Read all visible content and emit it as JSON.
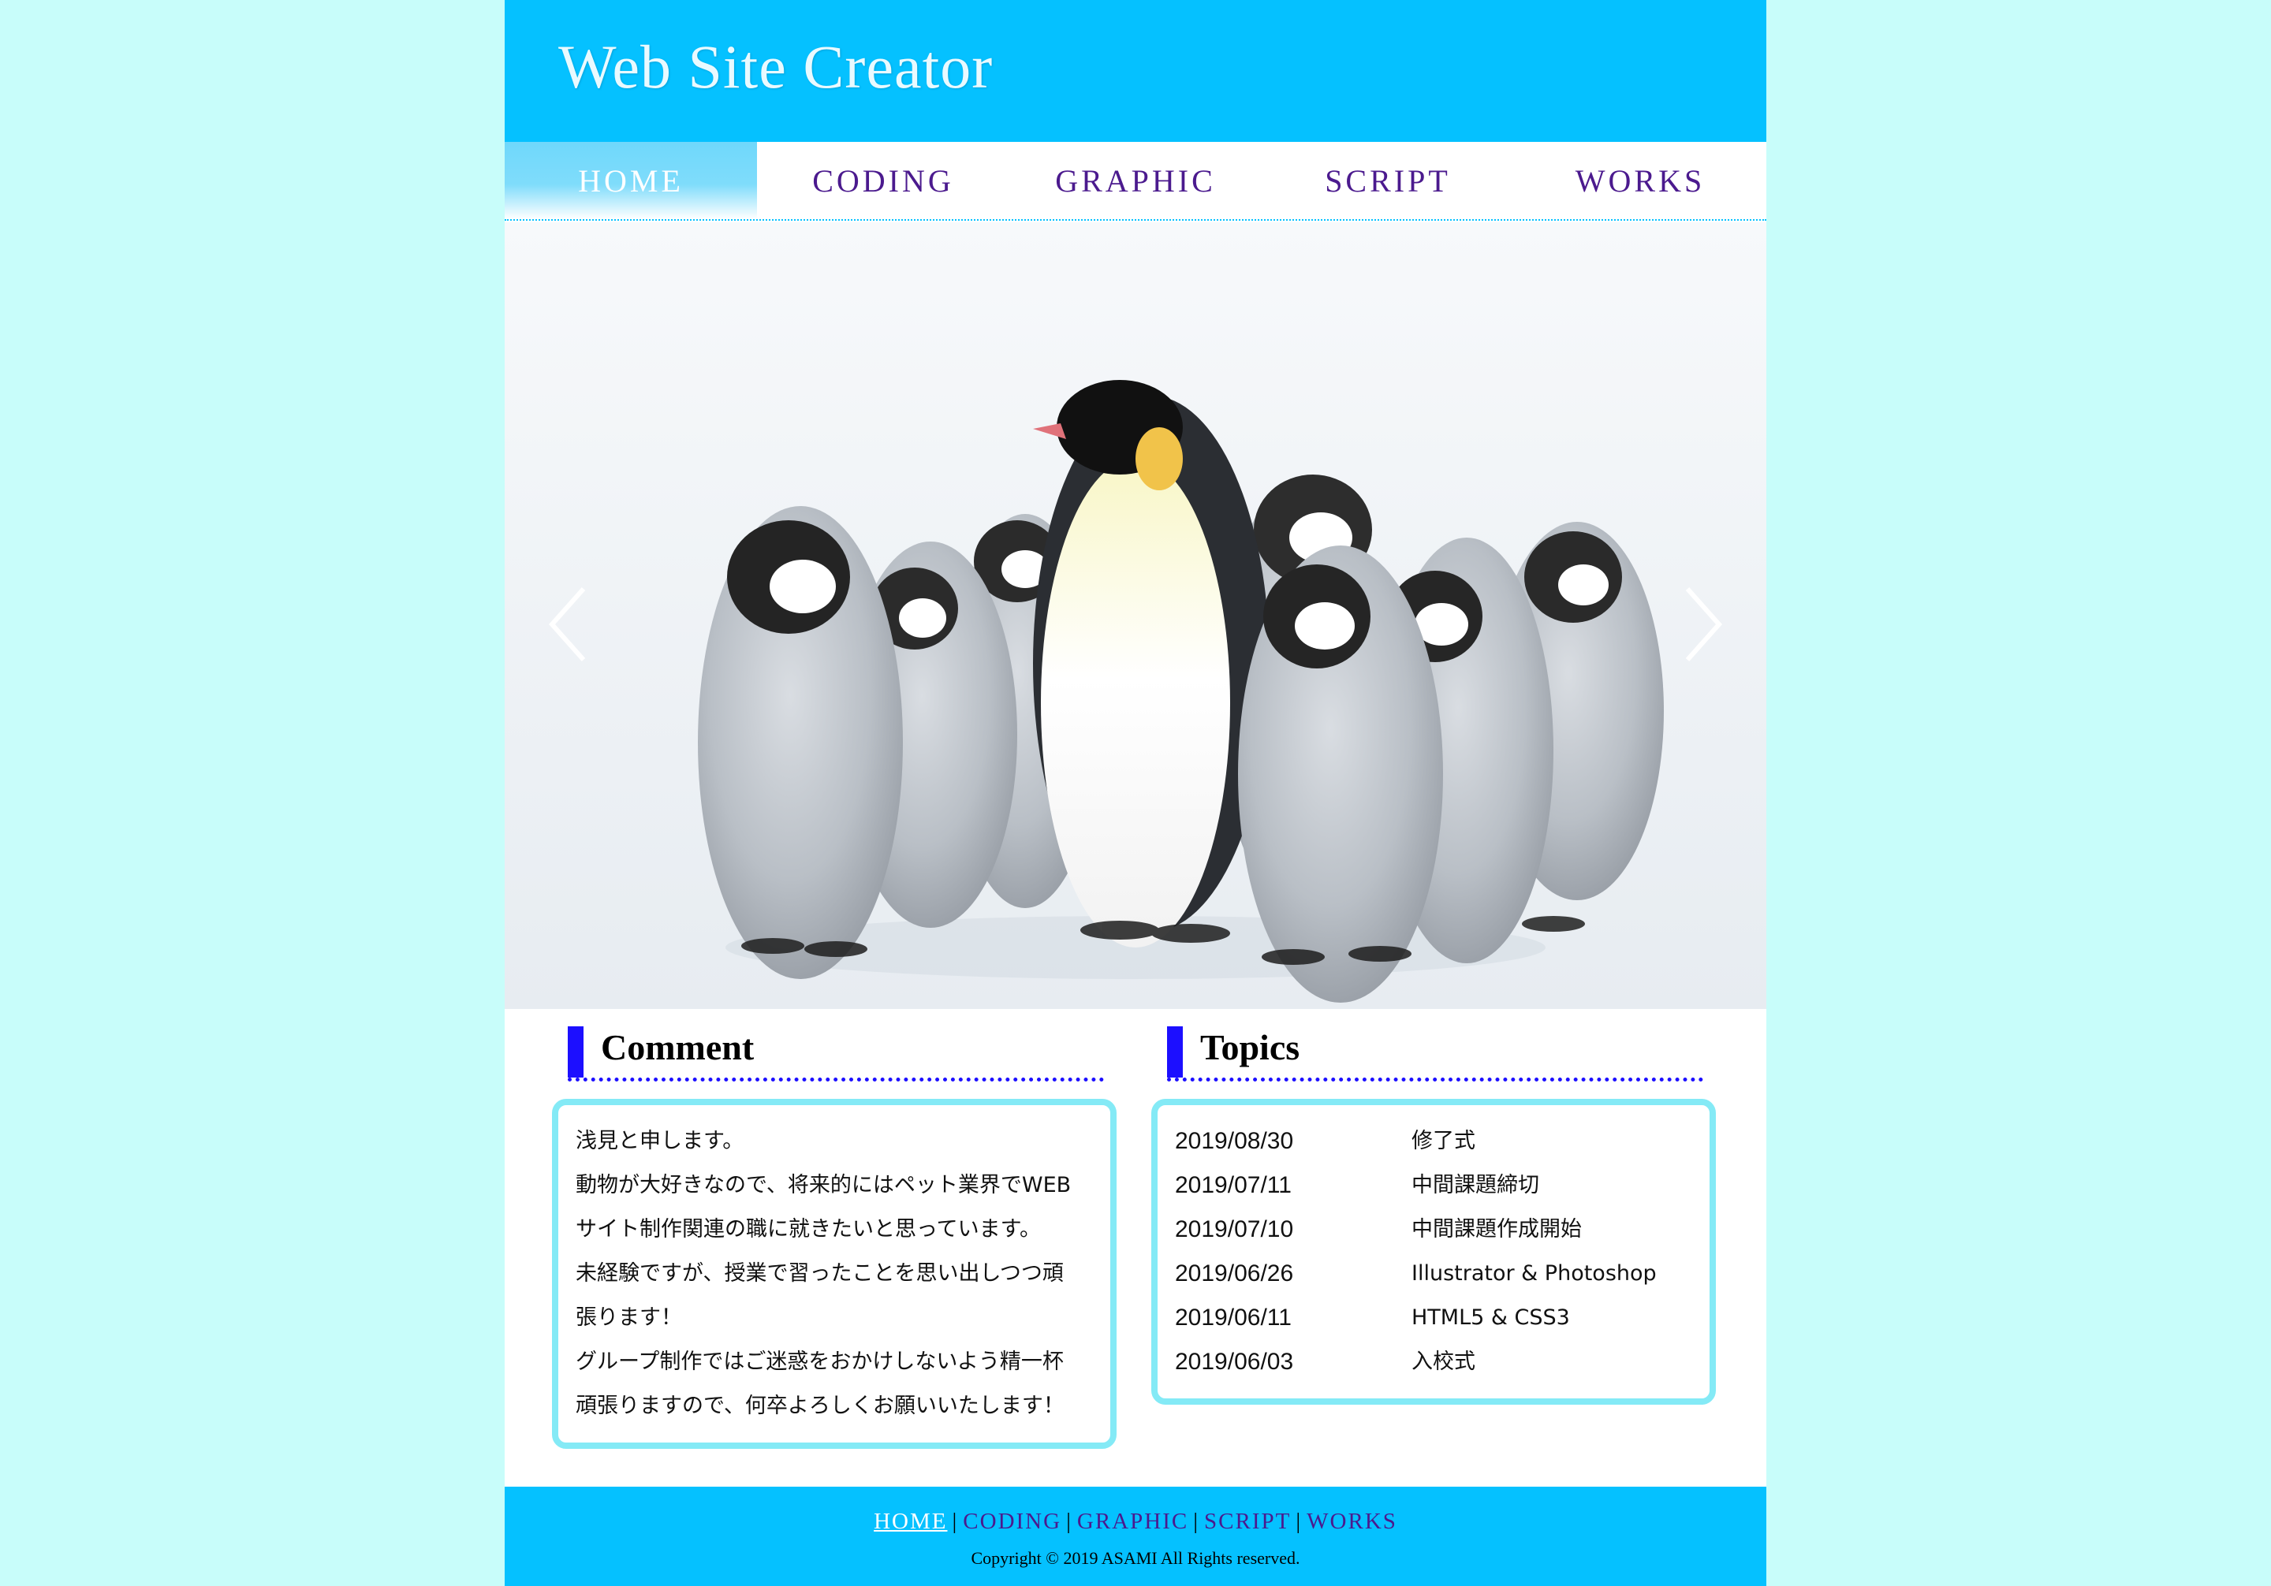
{
  "header": {
    "title": "Web Site Creator"
  },
  "nav": {
    "items": [
      {
        "label": "HOME",
        "active": true
      },
      {
        "label": "CODING",
        "active": false
      },
      {
        "label": "GRAPHIC",
        "active": false
      },
      {
        "label": "SCRIPT",
        "active": false
      },
      {
        "label": "WORKS",
        "active": false
      }
    ]
  },
  "hero": {
    "prev_icon": "chevron-left-icon",
    "next_icon": "chevron-right-icon"
  },
  "comment": {
    "heading": "Comment",
    "lines": [
      "浅見と申します。",
      "動物が大好きなので、将来的にはペット業界でWEB",
      "サイト制作関連の職に就きたいと思っています。",
      "未経験ですが、授業で習ったことを思い出しつつ頑",
      "張ります！",
      "グループ制作ではご迷惑をおかけしないよう精一杯",
      "頑張りますので、何卒よろしくお願いいたします！"
    ]
  },
  "topics": {
    "heading": "Topics",
    "rows": [
      {
        "date": "2019/08/30",
        "title": "修了式"
      },
      {
        "date": "2019/07/11",
        "title": "中間課題締切"
      },
      {
        "date": "2019/07/10",
        "title": "中間課題作成開始"
      },
      {
        "date": "2019/06/26",
        "title": "Illustrator & Photoshop"
      },
      {
        "date": "2019/06/11",
        "title": "HTML5 & CSS3"
      },
      {
        "date": "2019/06/03",
        "title": "入校式"
      }
    ]
  },
  "footer": {
    "links": [
      {
        "label": "HOME",
        "active": true
      },
      {
        "label": "CODING",
        "active": false
      },
      {
        "label": "GRAPHIC",
        "active": false
      },
      {
        "label": "SCRIPT",
        "active": false
      },
      {
        "label": "WORKS",
        "active": false
      }
    ],
    "separator": "|",
    "copyright": "Copyright © 2019 ASAMI All Rights reserved."
  },
  "colors": {
    "page_background": "#c8fdfa",
    "header_background": "#05c1ff",
    "nav_text": "#4b1a8e",
    "heading_accent": "#1c0fff",
    "box_border": "#84eaf6"
  }
}
